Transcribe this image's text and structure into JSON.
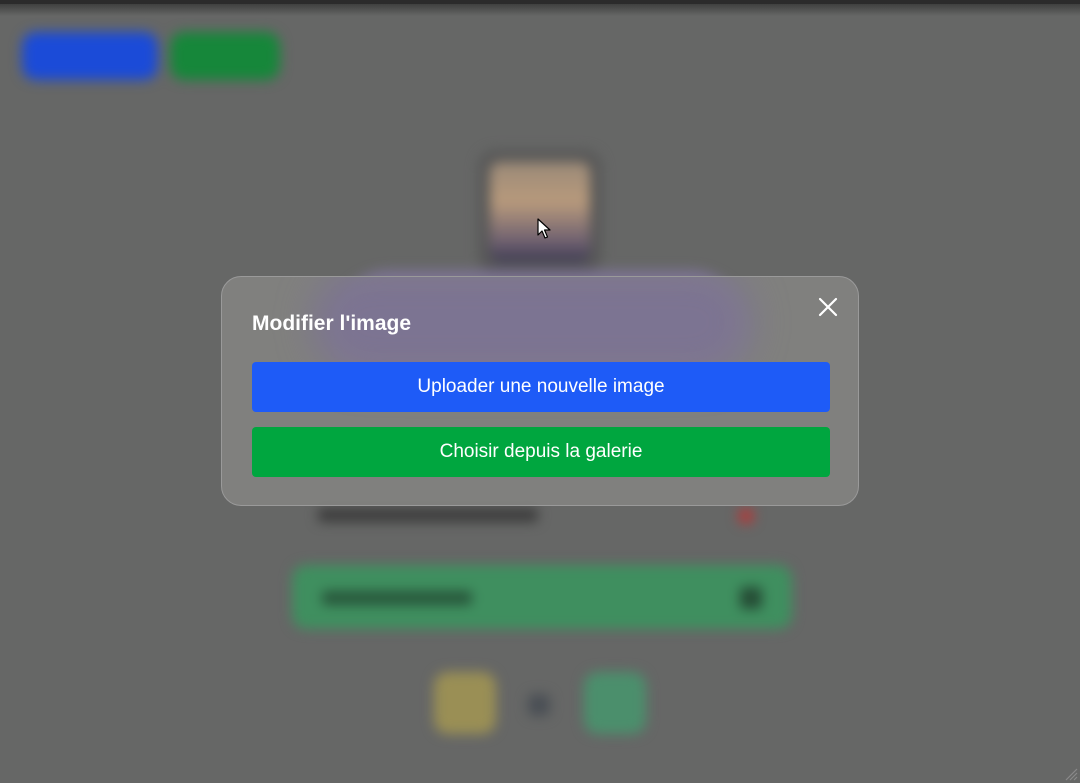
{
  "modal": {
    "title": "Modifier l'image",
    "upload_label": "Uploader une nouvelle image",
    "gallery_label": "Choisir depuis la galerie",
    "close_icon": "close-icon"
  },
  "colors": {
    "upload_button": "#1e5bf7",
    "gallery_button": "#00a63f",
    "overlay": "#666766",
    "modal_background": "#828280"
  }
}
